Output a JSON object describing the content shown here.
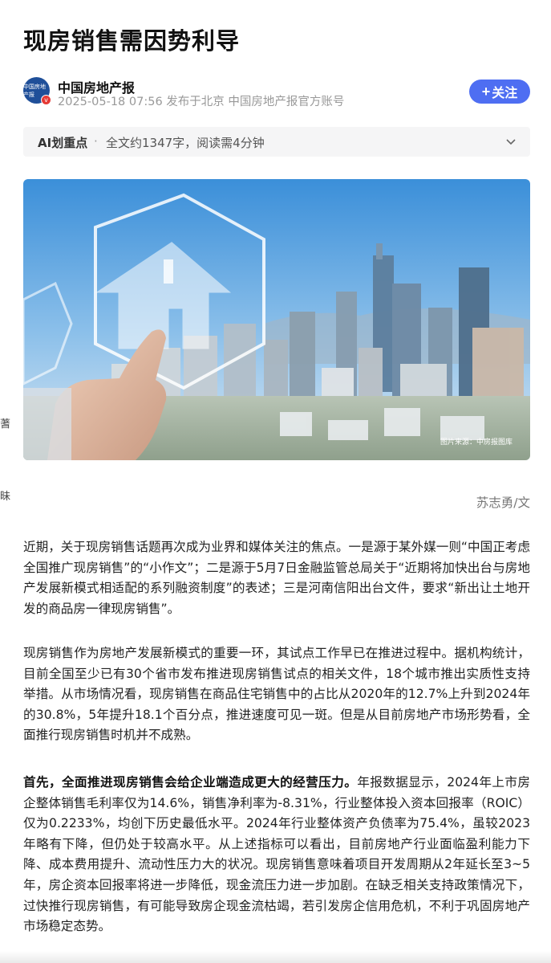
{
  "article": {
    "title": "现房销售需因势利导",
    "author": {
      "name": "中国房地产报",
      "meta": "2025-05-18 07:56 发布于北京 中国房地产报官方账号",
      "avatar_text": "中国房地产报",
      "avatar_badge": "v"
    },
    "follow_label": "关注",
    "follow_plus": "+",
    "ai_bar": {
      "label": "AI划重点",
      "dot": "·",
      "info": "全文约1347字，阅读需4分钟"
    },
    "image": {
      "credit": "图片来源：中房报图库"
    },
    "byline": "苏志勇/文",
    "paragraphs": [
      "近期，关于现房销售话题再次成为业界和媒体关注的焦点。一是源于某外媒一则“中国正考虑全国推广现房销售”的“小作文”；二是源于5月7日金融监管总局关于“近期将加快出台与房地产发展新模式相适配的系列融资制度”的表述；三是河南信阳出台文件，要求“新出让土地开发的商品房一律现房销售”。",
      "现房销售作为房地产发展新模式的重要一环，其试点工作早已在推进过程中。据机构统计，目前全国至少已有30个省市发布推进现房销售试点的相关文件，18个城市推出实质性支持举措。从市场情况看，现房销售在商品住宅销售中的占比从2020年的12.7%上升到2024年的30.8%，5年提升18.1个百分点，推进速度可见一斑。但是从目前房地产市场形势看，全面推行现房销售时机并不成熟。"
    ],
    "paragraph3": {
      "lead": "首先，全面推进现房销售会给企业端造成更大的经营压力。",
      "body": "年报数据显示，2024年上市房企整体销售毛利率仅为14.6%，销售净利率为-8.31%，行业整体投入资本回报率（ROIC）仅为0.2233%，均创下历史最低水平。2024年行业整体资产负债率为75.4%，虽较2023年略有下降，但仍处于较高水平。从上述指标可以看出，目前房地产行业面临盈利能力下降、成本费用提升、流动性压力大的状况。现房销售意味着项目开发周期从2年延长至3~5年，房企资本回报率将进一步降低，现金流压力进一步加剧。在缺乏相关支持政策情况下，过快推行现房销售，有可能导致房企现金流枯竭，若引发房企信用危机，不利于巩固房地产市场稳定态势。"
    }
  },
  "left_edge_glyphs": [
    "蓍",
    "昧"
  ],
  "colors": {
    "accent": "#4e6ef2",
    "meta_gray": "#999999",
    "ai_bar_bg": "#f5f5f6"
  }
}
